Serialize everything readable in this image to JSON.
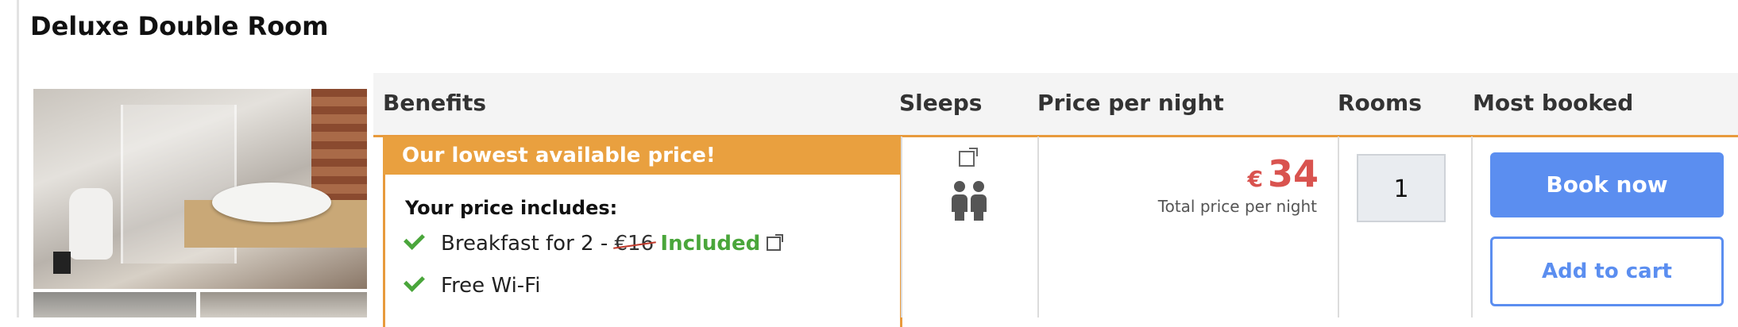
{
  "room": {
    "title": "Deluxe Double Room"
  },
  "headers": {
    "benefits": "Benefits",
    "sleeps": "Sleeps",
    "price_per_night": "Price per night",
    "rooms": "Rooms",
    "most_booked": "Most booked"
  },
  "offer": {
    "banner": "Our lowest available price!",
    "includes_label": "Your price includes:",
    "benefits": [
      {
        "text": "Breakfast for 2 - ",
        "old_price": "€16",
        "status": "Included"
      },
      {
        "text": "Free Wi-Fi"
      }
    ]
  },
  "sleeps": {
    "icon": "two-people-icon",
    "count": 2
  },
  "price": {
    "currency": "€",
    "amount": "34",
    "note": "Total price per night"
  },
  "rooms": {
    "value": "1"
  },
  "actions": {
    "book_now": "Book now",
    "add_to_cart": "Add to cart"
  },
  "colors": {
    "accent_orange": "#e89a3c",
    "primary_blue": "#5b8ef0",
    "price_red": "#d9534f",
    "check_green": "#4aa63b"
  }
}
